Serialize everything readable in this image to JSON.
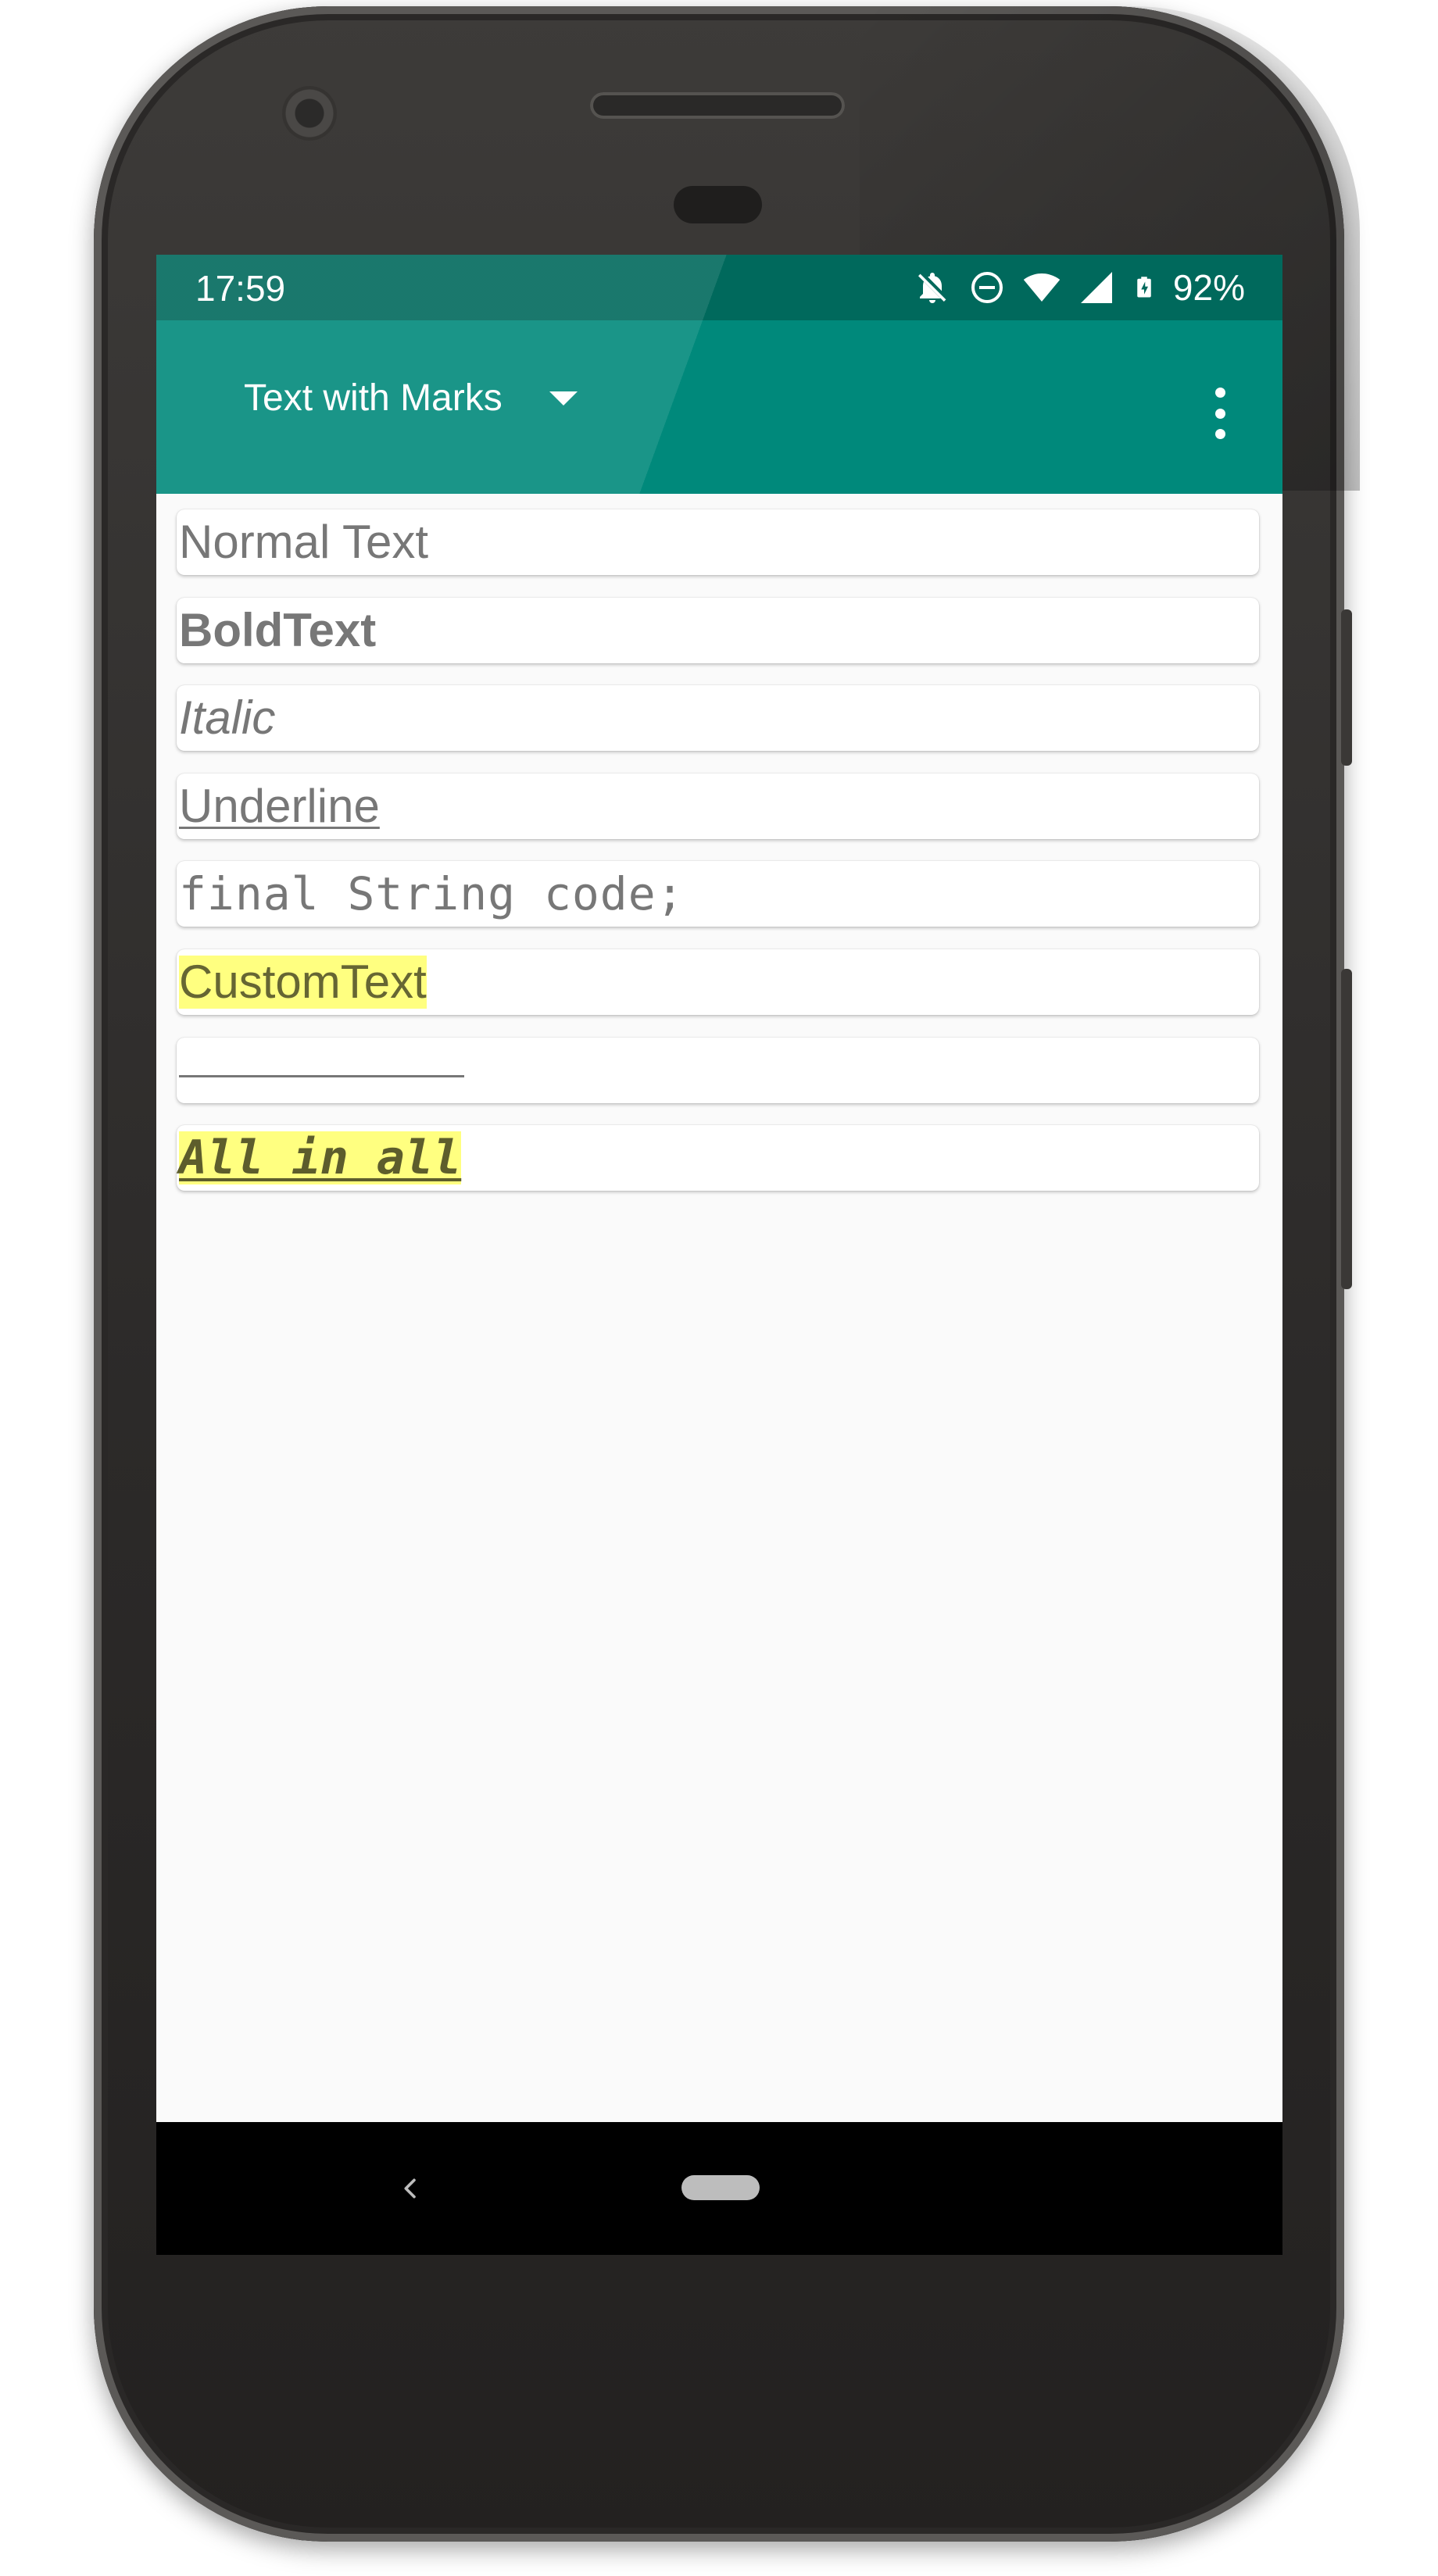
{
  "status_bar": {
    "time": "17:59",
    "battery_percent": "92%",
    "icons": [
      "notifications-off-icon",
      "do-not-disturb-icon",
      "wifi-icon",
      "cell-signal-icon",
      "battery-charging-icon"
    ]
  },
  "app_bar": {
    "spinner_label": "Text with Marks",
    "spinner_icon": "dropdown-caret-icon",
    "menu_icon": "overflow-menu-icon"
  },
  "fields": [
    {
      "text": "Normal Text",
      "style": "normal"
    },
    {
      "text": "BoldText",
      "style": "bold"
    },
    {
      "text": "Italic",
      "style": "italic"
    },
    {
      "text": "Underline",
      "style": "underline"
    },
    {
      "text": "final String code;",
      "style": "code"
    },
    {
      "text": "CustomText",
      "style": "custom-highlight"
    },
    {
      "text": "",
      "style": "blank-underline"
    },
    {
      "text": "All in all",
      "style": "all-combined"
    }
  ],
  "nav_bar": {
    "back_icon": "back-chevron-icon",
    "home_icon": "home-pill-icon"
  },
  "colors": {
    "status_bar": "#00695c",
    "app_bar": "#00897b",
    "field_text": "#777777",
    "highlight": "#ffff80",
    "screen_bg": "#fafafa",
    "nav_bar": "#000000"
  }
}
